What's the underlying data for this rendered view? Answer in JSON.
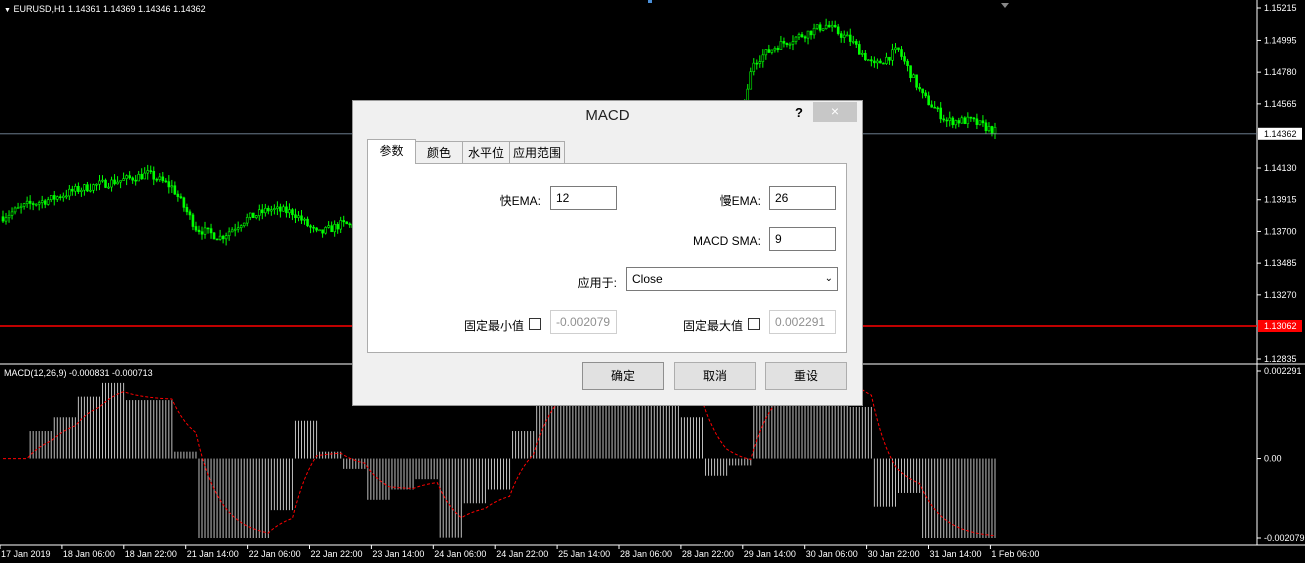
{
  "main_chart": {
    "header": "EURUSD,H1  1.14361 1.14369 1.14346 1.14362",
    "price_ticks": [
      "1.15215",
      "1.14995",
      "1.14780",
      "1.14565",
      "1.14130",
      "1.13915",
      "1.13700",
      "1.13485",
      "1.13270",
      "1.12835"
    ],
    "current_price_label": "1.14362",
    "red_line_label": "1.13062",
    "colors": {
      "candle": "#00ff00",
      "background": "#000000",
      "red_line": "#ff0000",
      "grid_axis": "#ffffff"
    }
  },
  "macd_pane": {
    "header": "MACD(12,26,9) -0.000831 -0.000713",
    "ticks": [
      "0.002291",
      "0.00",
      "-0.002079"
    ],
    "colors": {
      "histogram": "#c0c0c0",
      "signal": "#ff0000"
    }
  },
  "time_axis": [
    "17 Jan 2019",
    "18 Jan 06:00",
    "18 Jan 22:00",
    "21 Jan 14:00",
    "22 Jan 06:00",
    "22 Jan 22:00",
    "23 Jan 14:00",
    "24 Jan 06:00",
    "24 Jan 22:00",
    "25 Jan 14:00",
    "28 Jan 06:00",
    "28 Jan 22:00",
    "29 Jan 14:00",
    "30 Jan 06:00",
    "30 Jan 22:00",
    "31 Jan 14:00",
    "1 Feb 06:00"
  ],
  "dialog": {
    "title": "MACD",
    "help": "?",
    "close": "×",
    "tabs": [
      "参数",
      "颜色",
      "水平位",
      "应用范围"
    ],
    "fast_ema_label": "快EMA:",
    "fast_ema_value": "12",
    "slow_ema_label": "慢EMA:",
    "slow_ema_value": "26",
    "macd_sma_label": "MACD SMA:",
    "macd_sma_value": "9",
    "apply_to_label": "应用于:",
    "apply_to_value": "Close",
    "fixed_min_label": "固定最小值",
    "fixed_min_value": "-0.002079",
    "fixed_max_label": "固定最大值",
    "fixed_max_value": "0.002291",
    "ok": "确定",
    "cancel": "取消",
    "reset": "重设"
  },
  "chart_data": {
    "type": "line",
    "series": [
      {
        "values": [
          1.138,
          1.1388,
          1.1392,
          1.1398,
          1.1402,
          1.1405,
          1.1409,
          1.14,
          1.1372,
          1.1366,
          1.1378,
          1.1385,
          1.1383,
          1.1368,
          1.1375,
          1.1373,
          1.1374,
          1.1362,
          1.1352,
          1.136,
          1.1365,
          1.137,
          1.1378,
          1.1382,
          1.1388,
          1.1395,
          1.1404,
          1.1412,
          1.14,
          1.139,
          1.1402,
          1.1485,
          1.1496,
          1.1503,
          1.151,
          1.15,
          1.1482,
          1.1493,
          1.1462,
          1.1445,
          1.1445,
          1.1438
        ]
      }
    ]
  }
}
